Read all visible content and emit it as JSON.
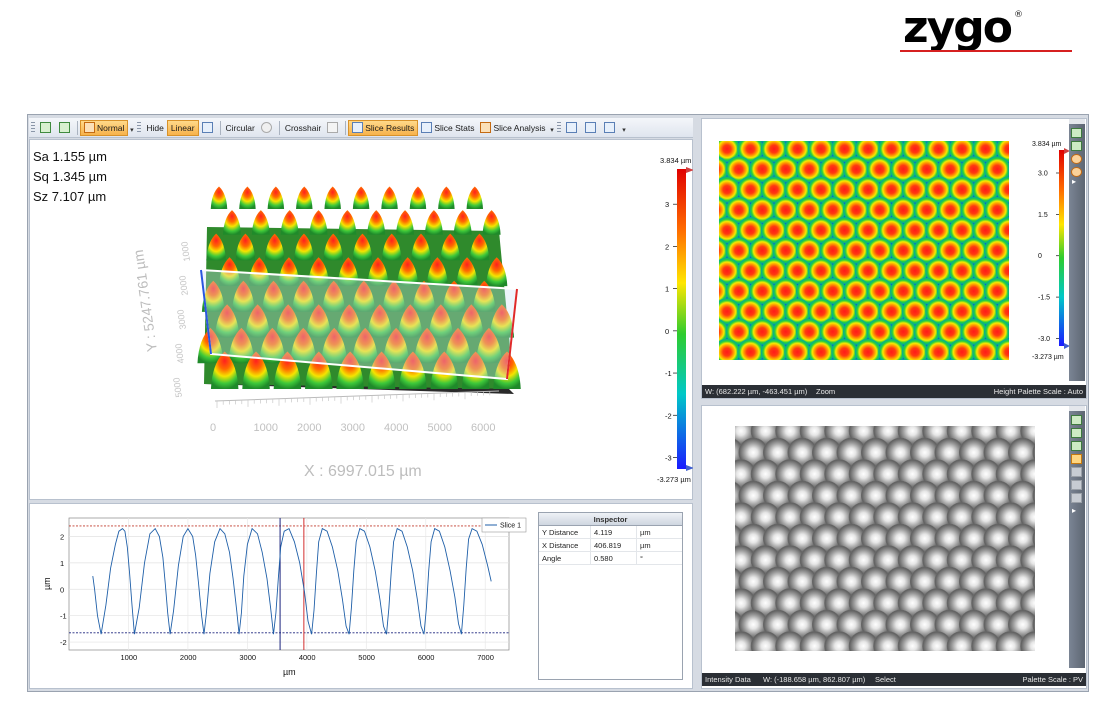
{
  "logo": {
    "text": "zygo",
    "registered": "®"
  },
  "toolbar": {
    "normal_label": "Normal",
    "hide_label": "Hide",
    "linear_label": "Linear",
    "circular_label": "Circular",
    "crosshair_label": "Crosshair",
    "slice_results_label": "Slice Results",
    "slice_stats_label": "Slice Stats",
    "slice_analysis_label": "Slice Analysis"
  },
  "stats": {
    "sa": "Sa 1.155 µm",
    "sq": "Sq 1.345 µm",
    "sz": "Sz 7.107 µm"
  },
  "view3d": {
    "x_axis_label": "X : 6997.015 µm",
    "y_axis_label": "Y : 5247.761 µm",
    "x_ticks": [
      "0",
      "1000",
      "2000",
      "3000",
      "4000",
      "5000",
      "6000"
    ],
    "y_ticks": [
      "5000",
      "4000",
      "3000",
      "2000",
      "1000"
    ],
    "colorbar": {
      "max_label": "3.834 µm",
      "min_label": "-3.273 µm",
      "ticks": [
        "3",
        "2",
        "1",
        "0",
        "-1",
        "-2",
        "-3"
      ]
    }
  },
  "map2d": {
    "colorbar": {
      "max_label": "3.834 µm",
      "min_label": "-3.273 µm",
      "ticks": [
        "3.0",
        "1.5",
        "0",
        "-1.5",
        "-3.0"
      ]
    },
    "status_coords": "W: (682.222 µm, -463.451 µm)",
    "status_mode": "Zoom",
    "status_scale": "Height Palette Scale : Auto"
  },
  "intensity": {
    "status_name": "Intensity Data",
    "status_coords": "W: (-188.658 µm, 862.807 µm)",
    "status_mode": "Select",
    "status_scale": "Palette Scale : PV"
  },
  "inspector": {
    "title": "Inspector",
    "rows": [
      {
        "name": "Y Distance",
        "value": "4.119",
        "unit": "µm"
      },
      {
        "name": "X Distance",
        "value": "406.819",
        "unit": "µm"
      },
      {
        "name": "Angle",
        "value": "0.580",
        "unit": "°"
      }
    ]
  },
  "chart_data": {
    "type": "line",
    "xlabel": "µm",
    "ylabel": "µm",
    "xlim": [
      0,
      7400
    ],
    "ylim": [
      -2.3,
      2.7
    ],
    "x_ticks": [
      1000,
      2000,
      3000,
      4000,
      5000,
      6000,
      7000
    ],
    "y_ticks": [
      2,
      1,
      0,
      -1,
      -2
    ],
    "series": [
      {
        "name": "Slice 1",
        "color": "#1f5fa8",
        "x": [
          400,
          430,
          480,
          540,
          620,
          700,
          780,
          840,
          900,
          940,
          980,
          1020,
          1060,
          1100,
          1180,
          1270,
          1360,
          1450,
          1520,
          1580,
          1620,
          1660,
          1700,
          1760,
          1840,
          1920,
          2000,
          2080,
          2130,
          2180,
          2230,
          2270,
          2310,
          2370,
          2450,
          2540,
          2620,
          2700,
          2760,
          2820,
          2860,
          2900,
          2940,
          3000,
          3080,
          3170,
          3250,
          3330,
          3390,
          3440,
          3480,
          3520,
          3560,
          3620,
          3700,
          3790,
          3880,
          3960,
          4020,
          4080,
          4120,
          4160,
          4200,
          4260,
          4340,
          4430,
          4520,
          4600,
          4660,
          4710,
          4750,
          4790,
          4830,
          4890,
          4970,
          5060,
          5150,
          5230,
          5290,
          5340,
          5380,
          5420,
          5460,
          5520,
          5600,
          5690,
          5780,
          5860,
          5920,
          5970,
          6010,
          6050,
          6090,
          6150,
          6230,
          6320,
          6410,
          6490,
          6550,
          6600,
          6640,
          6680,
          6720,
          6780,
          6860,
          6950,
          7040,
          7100
        ],
        "y": [
          0.5,
          0.0,
          -1.0,
          -1.7,
          -0.6,
          0.8,
          1.7,
          2.2,
          2.3,
          2.2,
          1.6,
          0.6,
          -0.6,
          -1.7,
          -0.7,
          1.0,
          2.1,
          2.3,
          2.0,
          1.2,
          0.2,
          -0.9,
          -1.7,
          -0.8,
          0.9,
          2.0,
          2.3,
          2.0,
          1.3,
          0.2,
          -1.0,
          -1.7,
          -0.9,
          0.6,
          1.8,
          2.3,
          2.1,
          1.4,
          0.4,
          -0.8,
          -1.7,
          -0.9,
          0.5,
          1.7,
          2.3,
          2.1,
          1.4,
          0.4,
          -0.7,
          -1.7,
          -0.9,
          0.4,
          1.6,
          2.2,
          2.3,
          1.8,
          1.0,
          -0.1,
          -1.2,
          -1.7,
          -0.8,
          0.6,
          1.8,
          2.3,
          2.2,
          1.6,
          0.7,
          -0.4,
          -1.4,
          -1.7,
          -0.7,
          0.7,
          1.8,
          2.3,
          2.2,
          1.6,
          0.7,
          -0.4,
          -1.4,
          -1.7,
          -0.7,
          0.7,
          1.8,
          2.3,
          2.2,
          1.6,
          0.7,
          -0.4,
          -1.4,
          -1.7,
          -0.7,
          0.7,
          1.8,
          2.3,
          2.2,
          1.6,
          0.7,
          -0.3,
          -1.3,
          -1.7,
          -0.6,
          0.8,
          1.9,
          2.3,
          2.2,
          1.7,
          0.9,
          0.3
        ]
      }
    ],
    "ref_lines": {
      "upper": 2.4,
      "lower": -1.65,
      "cursor_blue_x": 3550,
      "cursor_red_x": 3950
    }
  }
}
